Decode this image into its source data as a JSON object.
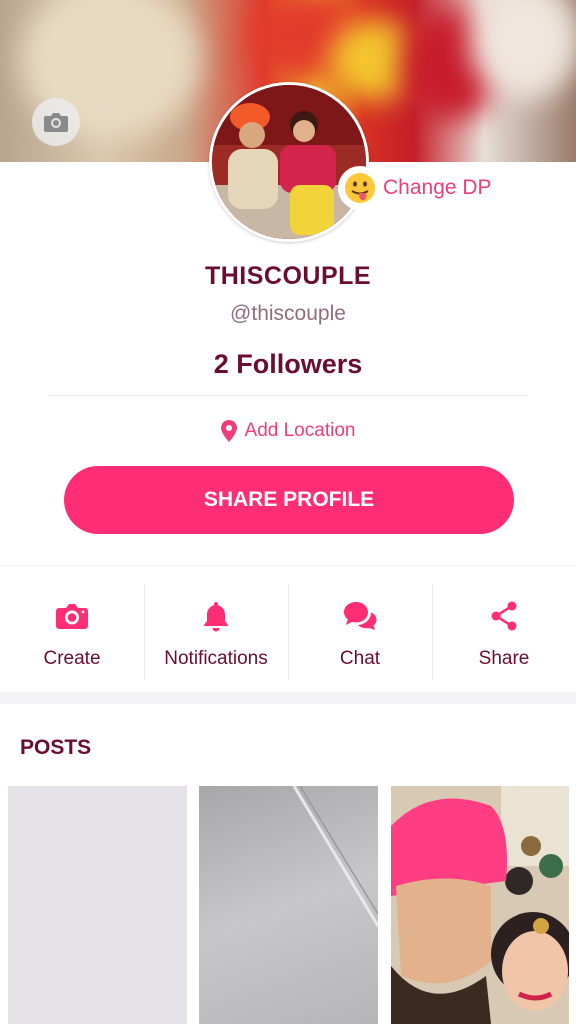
{
  "profile": {
    "name": "THISCOUPLE",
    "handle": "@thiscouple",
    "followers": "2 Followers",
    "change_dp_label": "Change DP",
    "add_location_label": "Add Location",
    "share_profile_label": "SHARE PROFILE"
  },
  "actions": [
    {
      "label": "Create",
      "icon": "camera-icon"
    },
    {
      "label": "Notifications",
      "icon": "bell-icon"
    },
    {
      "label": "Chat",
      "icon": "chat-bubbles-icon"
    },
    {
      "label": "Share",
      "icon": "share-icon"
    }
  ],
  "posts": {
    "title": "POSTS"
  },
  "colors": {
    "accent": "#ff2d73",
    "accent_text": "#ee3d7a",
    "heading": "#6b0d2e"
  }
}
